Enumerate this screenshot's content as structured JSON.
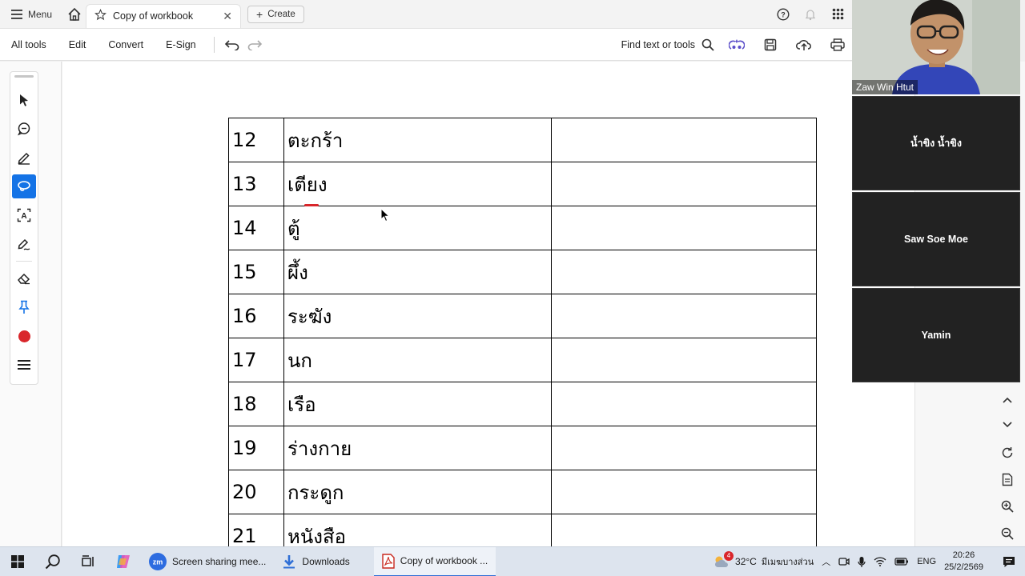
{
  "topbar": {
    "menu_label": "Menu",
    "tab_title": "Copy of workbook",
    "create_label": "Create"
  },
  "toolbar": {
    "all_tools": "All tools",
    "edit": "Edit",
    "convert": "Convert",
    "esign": "E-Sign",
    "find_label": "Find text or tools"
  },
  "document": {
    "rows": [
      {
        "num": "12",
        "word": "ตะกร้า",
        "answer": ""
      },
      {
        "num": "13",
        "word": "เตียง",
        "answer": ""
      },
      {
        "num": "14",
        "word": "ตู้",
        "answer": ""
      },
      {
        "num": "15",
        "word": "ผึ้ง",
        "answer": ""
      },
      {
        "num": "16",
        "word": "ระฆัง",
        "answer": ""
      },
      {
        "num": "17",
        "word": "นก",
        "answer": ""
      },
      {
        "num": "18",
        "word": "เรือ",
        "answer": ""
      },
      {
        "num": "19",
        "word": "ร่างกาย",
        "answer": ""
      },
      {
        "num": "20",
        "word": "กระดูก",
        "answer": ""
      },
      {
        "num": "21",
        "word": "หนังสือ",
        "answer": ""
      }
    ]
  },
  "participants": {
    "camera_name": "Zaw Win Htut",
    "tile1": "น้ำขิง น้ำขิง",
    "tile2": "Saw Soe Moe",
    "tile3": "Yamin"
  },
  "taskbar": {
    "app_zoom": "Screen sharing mee...",
    "app_downloads": "Downloads",
    "app_pdf": "Copy of workbook ...",
    "weather_temp": "32°C",
    "weather_desc": "มีเมฆบางส่วน",
    "notification_count": "4",
    "language": "ENG",
    "time": "20:26",
    "date": "25/2/2569"
  },
  "colors": {
    "accent": "#1473e6",
    "record_dot": "#d9262b"
  }
}
